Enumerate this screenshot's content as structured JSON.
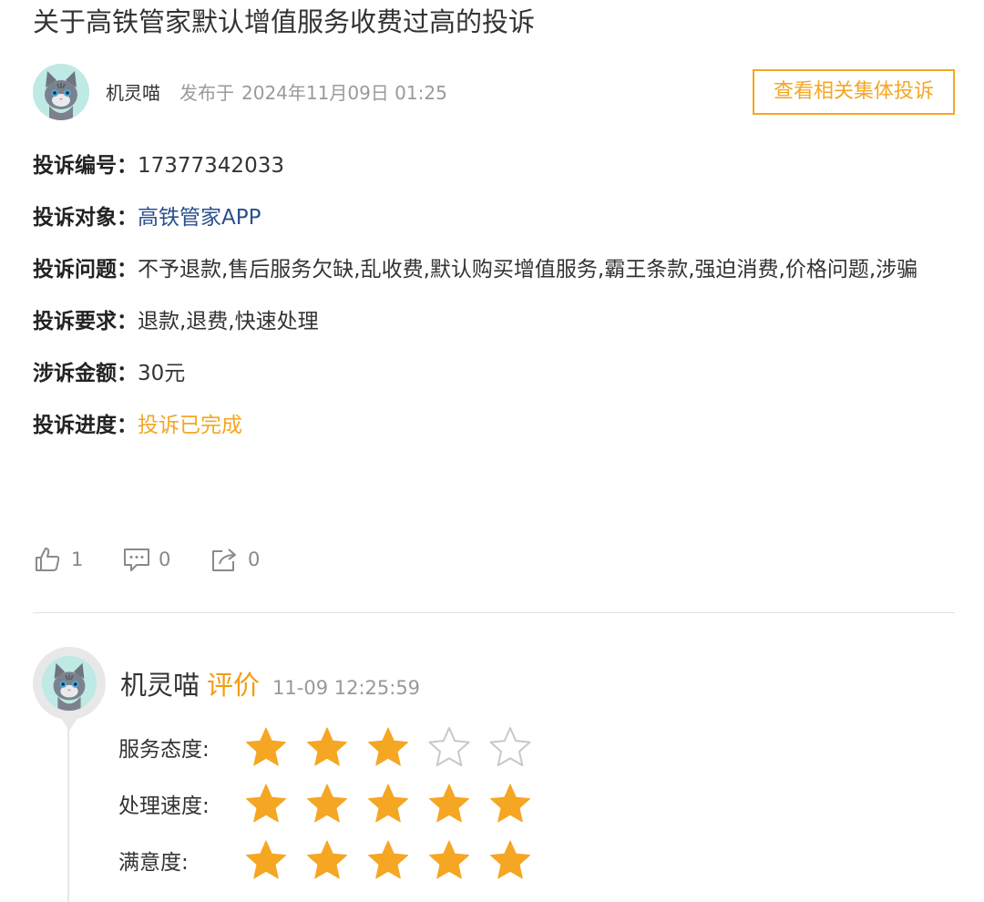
{
  "complaint": {
    "title": "关于高铁管家默认增值服务收费过高的投诉",
    "author": "机灵喵",
    "publish_prefix": "发布于",
    "publish_time": "2024年11月09日 01:25",
    "collective_button": "查看相关集体投诉",
    "fields": [
      {
        "label": "投诉编号：",
        "value": "17377342033"
      },
      {
        "label": "投诉对象：",
        "value": "高铁管家APP"
      },
      {
        "label": "投诉问题：",
        "value": "不予退款,售后服务欠缺,乱收费,默认购买增值服务,霸王条款,强迫消费,价格问题,涉骗"
      },
      {
        "label": "投诉要求：",
        "value": "退款,退费,快速处理"
      },
      {
        "label": "涉诉金额：",
        "value": "30元"
      },
      {
        "label": "投诉进度：",
        "value": "投诉已完成"
      }
    ],
    "actions": {
      "likes": "1",
      "comments": "0",
      "shares": "0"
    }
  },
  "review": {
    "author": "机灵喵",
    "tag": "评价",
    "time": "11-09 12:25:59",
    "ratings": [
      {
        "label": "服务态度:",
        "stars": 3,
        "max": 5
      },
      {
        "label": "处理速度:",
        "stars": 5,
        "max": 5
      },
      {
        "label": "满意度:",
        "stars": 5,
        "max": 5
      }
    ]
  },
  "colors": {
    "accent": "#f5a623",
    "link_blue": "#2a4f8f",
    "muted": "#9a9a9a",
    "star_filled": "#f5a623",
    "star_empty": "#c8c8c8"
  },
  "icons": {
    "like": "thumbs-up-icon",
    "comment": "comment-icon",
    "share": "share-icon",
    "star": "star-icon"
  }
}
